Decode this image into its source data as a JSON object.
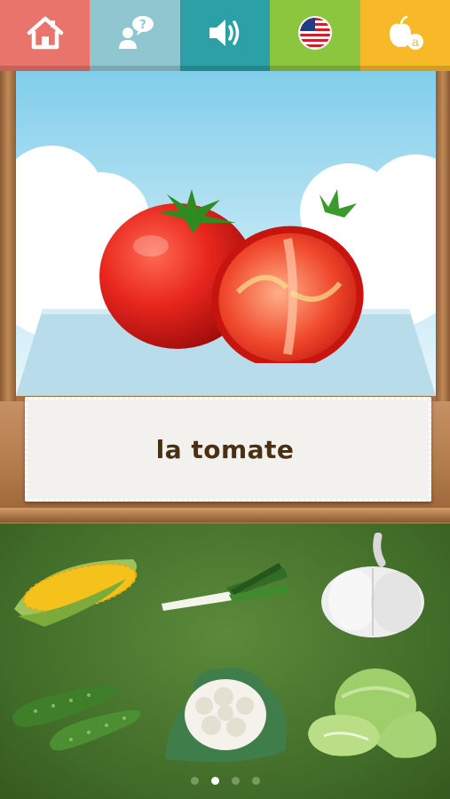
{
  "toolbar": {
    "buttons": [
      {
        "name": "home",
        "color": "#e8746b"
      },
      {
        "name": "help",
        "color": "#8fc6cf"
      },
      {
        "name": "sound",
        "color": "#2ba0a6"
      },
      {
        "name": "language",
        "color": "#8cc63f"
      },
      {
        "name": "game",
        "color": "#f7b928"
      }
    ]
  },
  "card": {
    "word": "la tomate"
  },
  "grid": {
    "items": [
      "corn",
      "leek",
      "garlic",
      "cucumber",
      "cauliflower",
      "cabbage"
    ]
  },
  "pager": {
    "pages": 4,
    "active_index": 1
  }
}
